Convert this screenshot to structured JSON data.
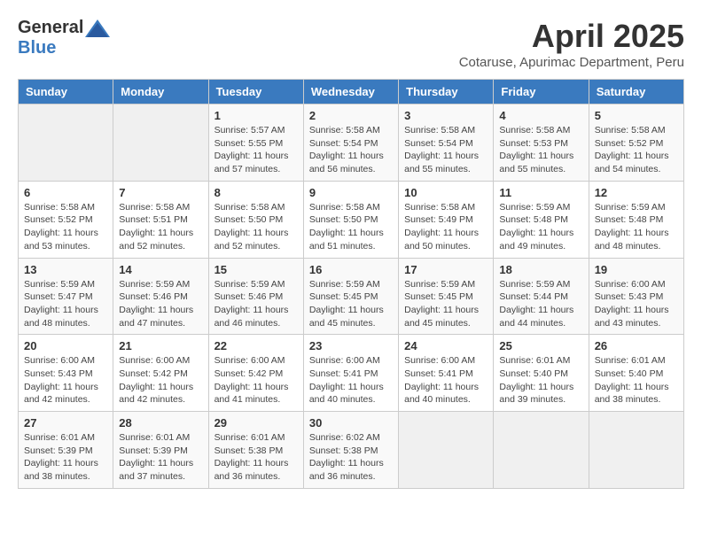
{
  "header": {
    "logo_general": "General",
    "logo_blue": "Blue",
    "title": "April 2025",
    "subtitle": "Cotaruse, Apurimac Department, Peru"
  },
  "days_of_week": [
    "Sunday",
    "Monday",
    "Tuesday",
    "Wednesday",
    "Thursday",
    "Friday",
    "Saturday"
  ],
  "weeks": [
    [
      {
        "day": "",
        "info": ""
      },
      {
        "day": "",
        "info": ""
      },
      {
        "day": "1",
        "info": "Sunrise: 5:57 AM\nSunset: 5:55 PM\nDaylight: 11 hours and 57 minutes."
      },
      {
        "day": "2",
        "info": "Sunrise: 5:58 AM\nSunset: 5:54 PM\nDaylight: 11 hours and 56 minutes."
      },
      {
        "day": "3",
        "info": "Sunrise: 5:58 AM\nSunset: 5:54 PM\nDaylight: 11 hours and 55 minutes."
      },
      {
        "day": "4",
        "info": "Sunrise: 5:58 AM\nSunset: 5:53 PM\nDaylight: 11 hours and 55 minutes."
      },
      {
        "day": "5",
        "info": "Sunrise: 5:58 AM\nSunset: 5:52 PM\nDaylight: 11 hours and 54 minutes."
      }
    ],
    [
      {
        "day": "6",
        "info": "Sunrise: 5:58 AM\nSunset: 5:52 PM\nDaylight: 11 hours and 53 minutes."
      },
      {
        "day": "7",
        "info": "Sunrise: 5:58 AM\nSunset: 5:51 PM\nDaylight: 11 hours and 52 minutes."
      },
      {
        "day": "8",
        "info": "Sunrise: 5:58 AM\nSunset: 5:50 PM\nDaylight: 11 hours and 52 minutes."
      },
      {
        "day": "9",
        "info": "Sunrise: 5:58 AM\nSunset: 5:50 PM\nDaylight: 11 hours and 51 minutes."
      },
      {
        "day": "10",
        "info": "Sunrise: 5:58 AM\nSunset: 5:49 PM\nDaylight: 11 hours and 50 minutes."
      },
      {
        "day": "11",
        "info": "Sunrise: 5:59 AM\nSunset: 5:48 PM\nDaylight: 11 hours and 49 minutes."
      },
      {
        "day": "12",
        "info": "Sunrise: 5:59 AM\nSunset: 5:48 PM\nDaylight: 11 hours and 48 minutes."
      }
    ],
    [
      {
        "day": "13",
        "info": "Sunrise: 5:59 AM\nSunset: 5:47 PM\nDaylight: 11 hours and 48 minutes."
      },
      {
        "day": "14",
        "info": "Sunrise: 5:59 AM\nSunset: 5:46 PM\nDaylight: 11 hours and 47 minutes."
      },
      {
        "day": "15",
        "info": "Sunrise: 5:59 AM\nSunset: 5:46 PM\nDaylight: 11 hours and 46 minutes."
      },
      {
        "day": "16",
        "info": "Sunrise: 5:59 AM\nSunset: 5:45 PM\nDaylight: 11 hours and 45 minutes."
      },
      {
        "day": "17",
        "info": "Sunrise: 5:59 AM\nSunset: 5:45 PM\nDaylight: 11 hours and 45 minutes."
      },
      {
        "day": "18",
        "info": "Sunrise: 5:59 AM\nSunset: 5:44 PM\nDaylight: 11 hours and 44 minutes."
      },
      {
        "day": "19",
        "info": "Sunrise: 6:00 AM\nSunset: 5:43 PM\nDaylight: 11 hours and 43 minutes."
      }
    ],
    [
      {
        "day": "20",
        "info": "Sunrise: 6:00 AM\nSunset: 5:43 PM\nDaylight: 11 hours and 42 minutes."
      },
      {
        "day": "21",
        "info": "Sunrise: 6:00 AM\nSunset: 5:42 PM\nDaylight: 11 hours and 42 minutes."
      },
      {
        "day": "22",
        "info": "Sunrise: 6:00 AM\nSunset: 5:42 PM\nDaylight: 11 hours and 41 minutes."
      },
      {
        "day": "23",
        "info": "Sunrise: 6:00 AM\nSunset: 5:41 PM\nDaylight: 11 hours and 40 minutes."
      },
      {
        "day": "24",
        "info": "Sunrise: 6:00 AM\nSunset: 5:41 PM\nDaylight: 11 hours and 40 minutes."
      },
      {
        "day": "25",
        "info": "Sunrise: 6:01 AM\nSunset: 5:40 PM\nDaylight: 11 hours and 39 minutes."
      },
      {
        "day": "26",
        "info": "Sunrise: 6:01 AM\nSunset: 5:40 PM\nDaylight: 11 hours and 38 minutes."
      }
    ],
    [
      {
        "day": "27",
        "info": "Sunrise: 6:01 AM\nSunset: 5:39 PM\nDaylight: 11 hours and 38 minutes."
      },
      {
        "day": "28",
        "info": "Sunrise: 6:01 AM\nSunset: 5:39 PM\nDaylight: 11 hours and 37 minutes."
      },
      {
        "day": "29",
        "info": "Sunrise: 6:01 AM\nSunset: 5:38 PM\nDaylight: 11 hours and 36 minutes."
      },
      {
        "day": "30",
        "info": "Sunrise: 6:02 AM\nSunset: 5:38 PM\nDaylight: 11 hours and 36 minutes."
      },
      {
        "day": "",
        "info": ""
      },
      {
        "day": "",
        "info": ""
      },
      {
        "day": "",
        "info": ""
      }
    ]
  ]
}
